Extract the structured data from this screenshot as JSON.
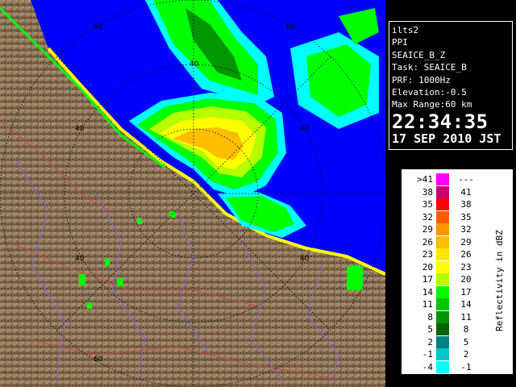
{
  "info": {
    "lines": [
      "ilts2",
      "PPI",
      "SEAICE_B_Z",
      "Task: SEAICE_B",
      "PRF: 1000Hz",
      "Elevation:-0.5",
      "Max Range:60 km"
    ],
    "time": "22:34:35",
    "date": "17 SEP 2010 JST"
  },
  "legend": {
    "title": "Reflectivity in dBZ",
    "rows": [
      {
        "low": ">41",
        "high": "---",
        "color": "#ff00ff"
      },
      {
        "low": "38",
        "high": "41",
        "color": "#c8006e"
      },
      {
        "low": "35",
        "high": "38",
        "color": "#ff0000"
      },
      {
        "low": "32",
        "high": "35",
        "color": "#ff5a00"
      },
      {
        "low": "29",
        "high": "32",
        "color": "#ff9600"
      },
      {
        "low": "26",
        "high": "29",
        "color": "#ffbe00"
      },
      {
        "low": "23",
        "high": "26",
        "color": "#ffe600"
      },
      {
        "low": "20",
        "high": "23",
        "color": "#ffff00"
      },
      {
        "low": "17",
        "high": "20",
        "color": "#b4ff00"
      },
      {
        "low": "14",
        "high": "17",
        "color": "#00ff00"
      },
      {
        "low": "11",
        "high": "14",
        "color": "#00c800"
      },
      {
        "low": "8",
        "high": "11",
        "color": "#009600"
      },
      {
        "low": "5",
        "high": "8",
        "color": "#006400"
      },
      {
        "low": "2",
        "high": "5",
        "color": "#008080"
      },
      {
        "low": "-1",
        "high": "2",
        "color": "#00c8c8"
      },
      {
        "low": "-4",
        "high": "-1",
        "color": "#00ffff"
      }
    ]
  },
  "radar": {
    "range_labels": [
      "60",
      "60",
      "40",
      "40",
      "40",
      "40",
      "40",
      "60"
    ]
  }
}
